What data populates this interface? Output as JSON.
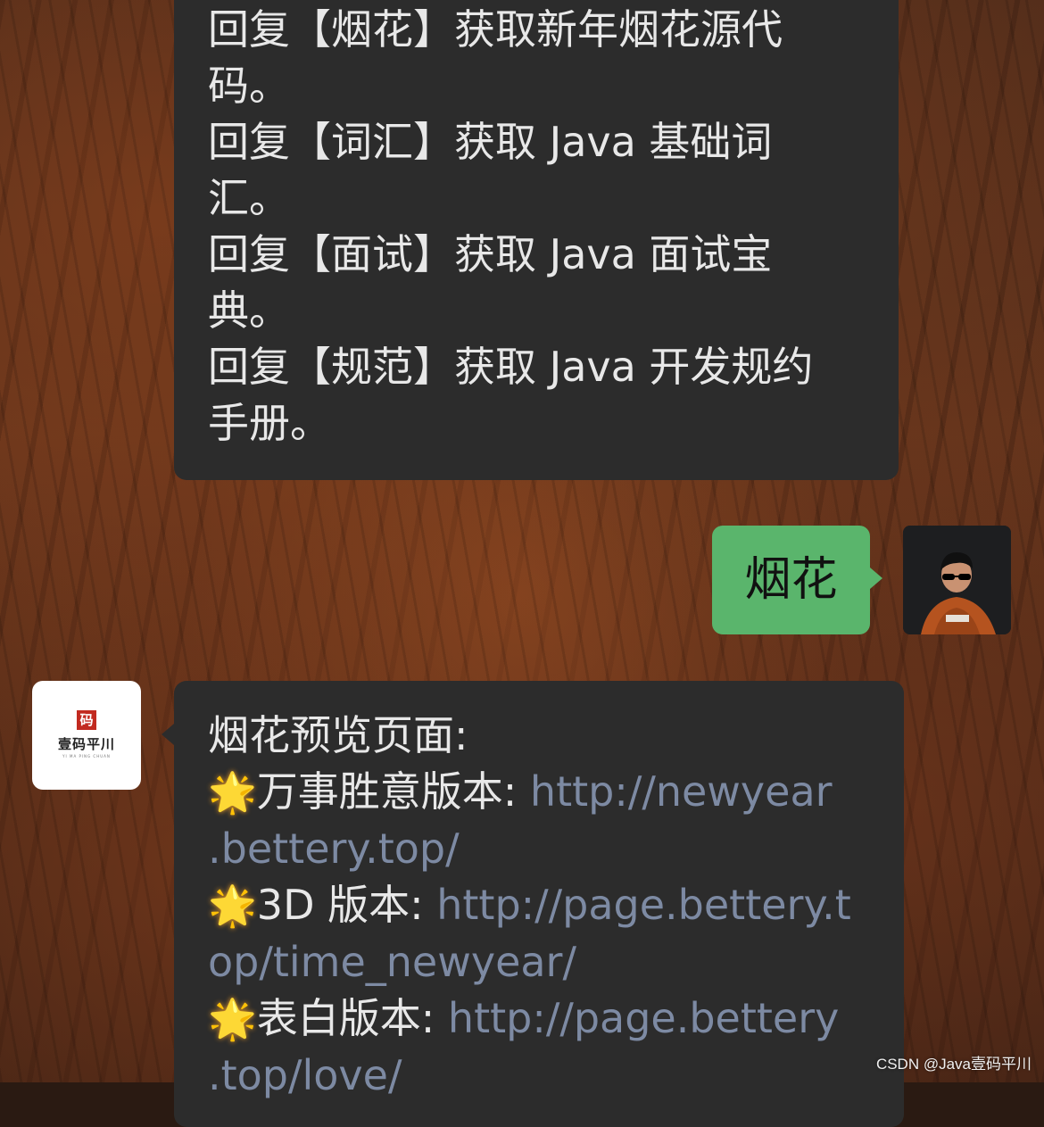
{
  "messages": {
    "bot_menu": {
      "lines": [
        "回复【烟花】获取新年烟花源代",
        "码。",
        "回复【词汇】获取 Java 基础词",
        "汇。",
        "回复【面试】获取 Java 面试宝",
        "典。",
        "回复【规范】获取 Java 开发规约",
        "手册。"
      ]
    },
    "user_reply": {
      "text": "烟花"
    },
    "bot_links": {
      "heading": "烟花预览页面:",
      "items": [
        {
          "icon": "star-emoji",
          "label": "万事胜意版本: ",
          "url_part1": "http://newyear",
          "url_part2": ".bettery.top/"
        },
        {
          "icon": "star-emoji",
          "label": "3D 版本: ",
          "url_part1": "http://page.bettery.t",
          "url_part2": "op/time_newyear/"
        },
        {
          "icon": "star-emoji",
          "label": "表白版本: ",
          "url_part1": "http://page.bettery",
          "url_part2": ".top/love/"
        }
      ]
    }
  },
  "avatars": {
    "bot": {
      "seal_char": "码",
      "brand": "壹码平川",
      "brand_sub": "YI MA PING CHUAN"
    },
    "me": {
      "icon": "person-photo"
    }
  },
  "watermark": "CSDN @Java壹码平川",
  "colors": {
    "bubble_dark": "#2c2c2c",
    "bubble_green": "#5ab56c",
    "link": "#7d8aa3",
    "text": "#e8e8e8"
  }
}
